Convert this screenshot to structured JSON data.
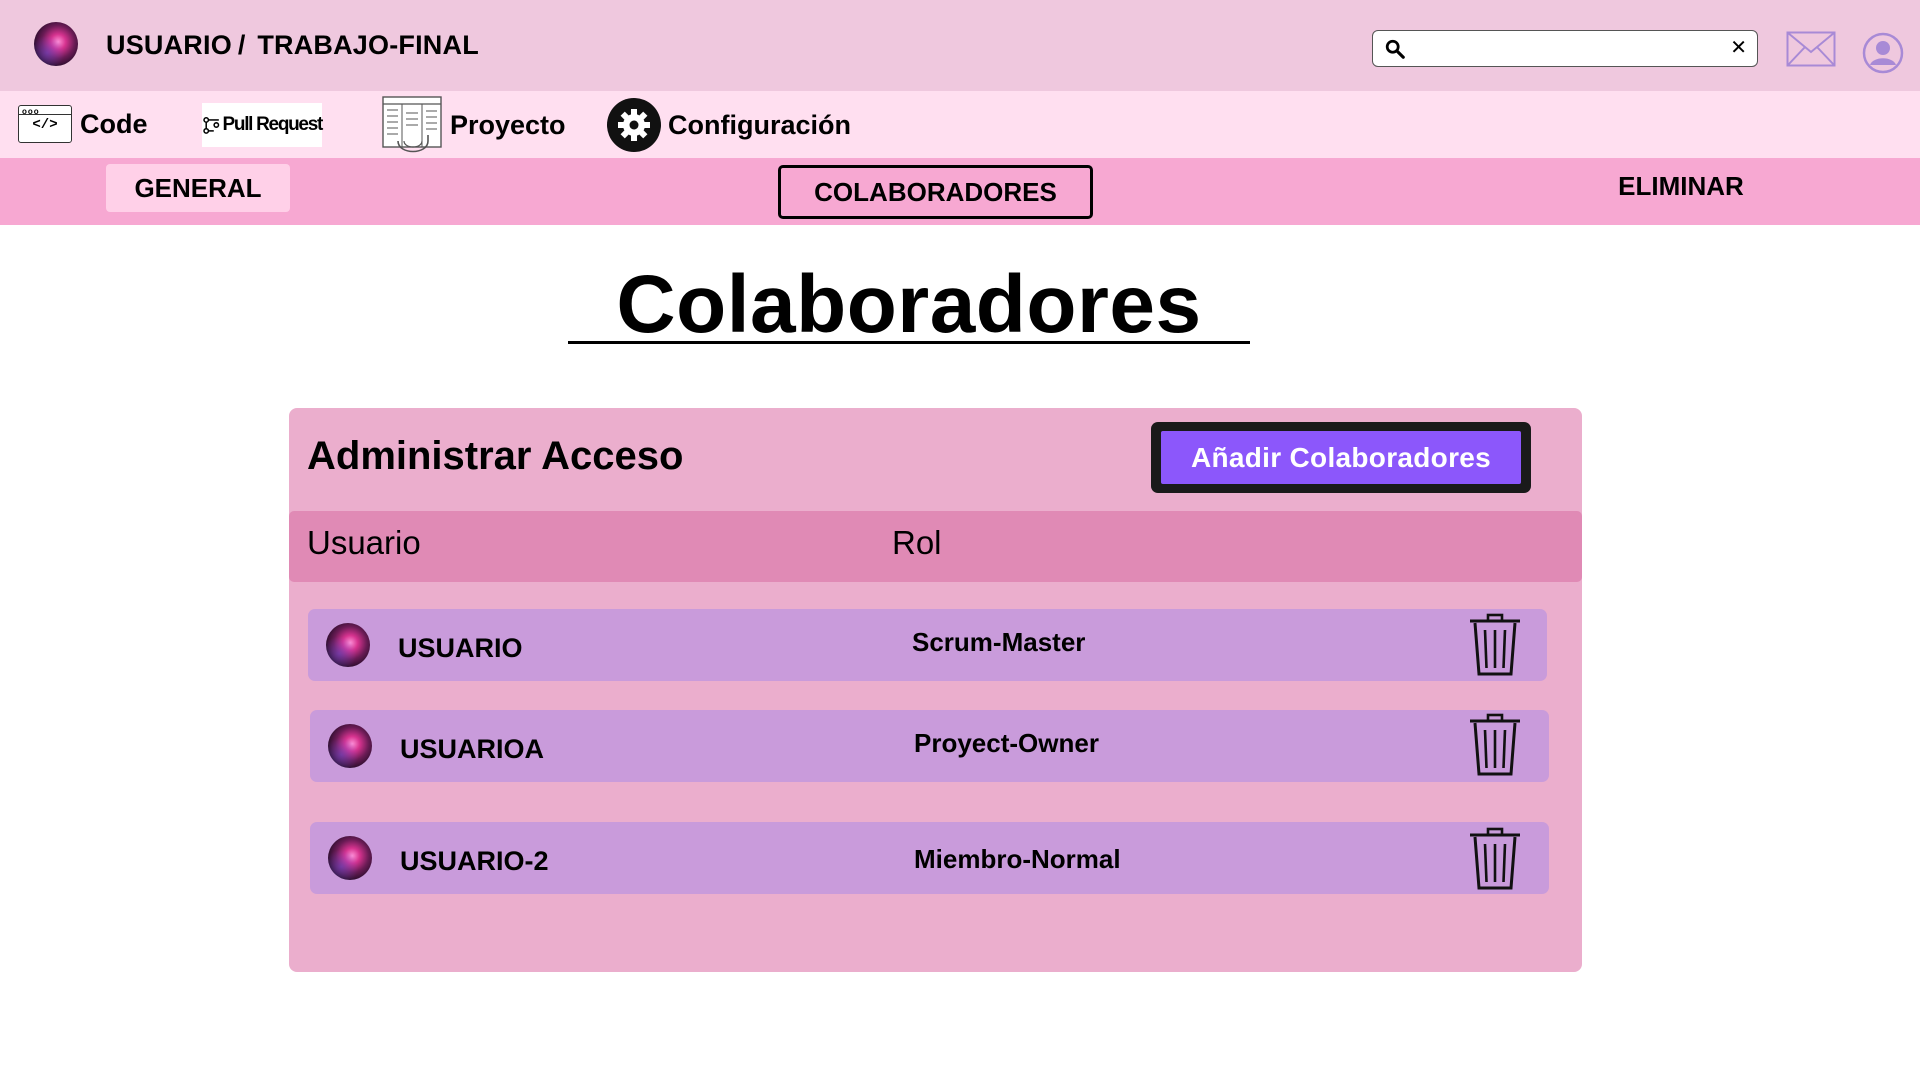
{
  "header": {
    "user": "USUARIO",
    "separator": "/",
    "repo": "TRABAJO-FINAL",
    "search": {
      "value": "",
      "placeholder": "",
      "clear_symbol": "✕"
    },
    "icons": [
      "search-icon",
      "mail-icon",
      "user-icon"
    ]
  },
  "nav": {
    "code_label": "Code",
    "code_tag": "</>",
    "pull_request_label": "Pull Request",
    "proyecto_label": "Proyecto",
    "configuracion_label": "Configuración"
  },
  "tabs": {
    "general": "GENERAL",
    "colaboradores": "COLABORADORES",
    "eliminar": "ELIMINAR",
    "active": "COLABORADORES"
  },
  "page": {
    "title": "Colaboradores"
  },
  "panel": {
    "title": "Administrar Acceso",
    "add_button": "Añadir Colaboradores",
    "columns": {
      "user": "Usuario",
      "role": "Rol"
    },
    "rows": [
      {
        "user": "USUARIO",
        "role": "Scrum-Master"
      },
      {
        "user": "USUARIOA",
        "role": "Proyect-Owner"
      },
      {
        "user": "USUARIO-2",
        "role": "Miembro-Normal"
      }
    ]
  },
  "colors": {
    "header_bg": "#efc8de",
    "nav_bg": "#ffdff0",
    "tabs_bg": "#f7a8d2",
    "panel_bg": "#ebaecd",
    "table_head_bg": "#e08ab5",
    "row_bg": "#c99bdb",
    "accent_button": "#8c57fb"
  }
}
